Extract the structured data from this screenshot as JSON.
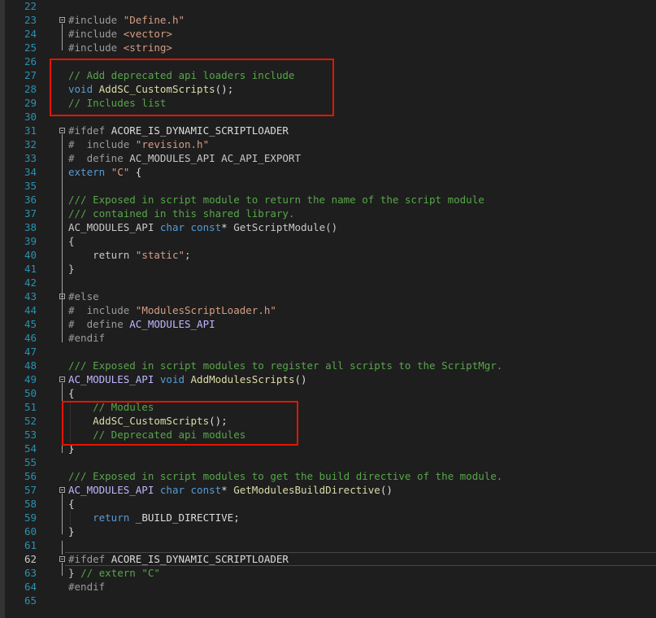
{
  "editor": {
    "current_line": 62,
    "lines": [
      {
        "n": 22,
        "tokens": []
      },
      {
        "n": 23,
        "tokens": [
          {
            "c": "pre",
            "t": "#include "
          },
          {
            "c": "str",
            "t": "\"Define.h\""
          }
        ]
      },
      {
        "n": 24,
        "tokens": [
          {
            "c": "pre",
            "t": "#include "
          },
          {
            "c": "str",
            "t": "<vector>"
          }
        ]
      },
      {
        "n": 25,
        "tokens": [
          {
            "c": "pre",
            "t": "#include "
          },
          {
            "c": "str",
            "t": "<string>"
          }
        ]
      },
      {
        "n": 26,
        "tokens": []
      },
      {
        "n": 27,
        "tokens": [
          {
            "c": "com",
            "t": "// Add deprecated api loaders include"
          }
        ]
      },
      {
        "n": 28,
        "tokens": [
          {
            "c": "kw",
            "t": "void "
          },
          {
            "c": "fn",
            "t": "AddSC_CustomScripts"
          },
          {
            "c": "txt",
            "t": "();"
          }
        ]
      },
      {
        "n": 29,
        "tokens": [
          {
            "c": "com",
            "t": "// Includes list"
          }
        ]
      },
      {
        "n": 30,
        "tokens": []
      },
      {
        "n": 31,
        "tokens": [
          {
            "c": "pre",
            "t": "#ifdef "
          },
          {
            "c": "txt",
            "t": "ACORE_IS_DYNAMIC_SCRIPTLOADER"
          }
        ]
      },
      {
        "n": 32,
        "tokens": [
          {
            "c": "pre",
            "t": "#  include "
          },
          {
            "c": "str",
            "t": "\"revision.h\""
          }
        ]
      },
      {
        "n": 33,
        "tokens": [
          {
            "c": "pre",
            "t": "#  define "
          },
          {
            "c": "def",
            "t": "AC_MODULES_API AC_API_EXPORT"
          }
        ]
      },
      {
        "n": 34,
        "tokens": [
          {
            "c": "kw",
            "t": "extern "
          },
          {
            "c": "str",
            "t": "\"C\""
          },
          {
            "c": "txt",
            "t": " {"
          }
        ]
      },
      {
        "n": 35,
        "tokens": []
      },
      {
        "n": 36,
        "tokens": [
          {
            "c": "com",
            "t": "/// Exposed in script module to return the name of the script module"
          }
        ]
      },
      {
        "n": 37,
        "tokens": [
          {
            "c": "com",
            "t": "/// contained in this shared library."
          }
        ]
      },
      {
        "n": 38,
        "tokens": [
          {
            "c": "def",
            "t": "AC_MODULES_API "
          },
          {
            "c": "kw",
            "t": "char const"
          },
          {
            "c": "txt",
            "t": "* "
          },
          {
            "c": "def",
            "t": "GetScriptModule()"
          }
        ]
      },
      {
        "n": 39,
        "tokens": [
          {
            "c": "def",
            "t": "{"
          }
        ]
      },
      {
        "n": 40,
        "tokens": [
          {
            "c": "def",
            "t": "    return "
          },
          {
            "c": "str",
            "t": "\"static\""
          },
          {
            "c": "def",
            "t": ";"
          }
        ]
      },
      {
        "n": 41,
        "tokens": [
          {
            "c": "def",
            "t": "}"
          }
        ]
      },
      {
        "n": 42,
        "tokens": []
      },
      {
        "n": 43,
        "tokens": [
          {
            "c": "pre",
            "t": "#else"
          }
        ]
      },
      {
        "n": 44,
        "tokens": [
          {
            "c": "pre",
            "t": "#  include "
          },
          {
            "c": "str",
            "t": "\"ModulesScriptLoader.h\""
          }
        ]
      },
      {
        "n": 45,
        "tokens": [
          {
            "c": "pre",
            "t": "#  define "
          },
          {
            "c": "macd",
            "t": "AC_MODULES_API"
          }
        ]
      },
      {
        "n": 46,
        "tokens": [
          {
            "c": "pre",
            "t": "#endif"
          }
        ]
      },
      {
        "n": 47,
        "tokens": []
      },
      {
        "n": 48,
        "tokens": [
          {
            "c": "com",
            "t": "/// Exposed in script modules to register all scripts to the ScriptMgr."
          }
        ]
      },
      {
        "n": 49,
        "tokens": [
          {
            "c": "macd",
            "t": "AC_MODULES_API "
          },
          {
            "c": "kw",
            "t": "void "
          },
          {
            "c": "fn",
            "t": "AddModulesScripts"
          },
          {
            "c": "txt",
            "t": "()"
          }
        ]
      },
      {
        "n": 50,
        "tokens": [
          {
            "c": "txt",
            "t": "{"
          }
        ]
      },
      {
        "n": 51,
        "tokens": [
          {
            "c": "com",
            "t": "    // Modules"
          }
        ]
      },
      {
        "n": 52,
        "tokens": [
          {
            "c": "fn",
            "t": "    AddSC_CustomScripts"
          },
          {
            "c": "txt",
            "t": "();"
          }
        ]
      },
      {
        "n": 53,
        "tokens": [
          {
            "c": "com",
            "t": "    // Deprecated api modules"
          }
        ]
      },
      {
        "n": 54,
        "tokens": [
          {
            "c": "txt",
            "t": "}"
          }
        ]
      },
      {
        "n": 55,
        "tokens": []
      },
      {
        "n": 56,
        "tokens": [
          {
            "c": "com",
            "t": "/// Exposed in script modules to get the build directive of the module."
          }
        ]
      },
      {
        "n": 57,
        "tokens": [
          {
            "c": "macd",
            "t": "AC_MODULES_API "
          },
          {
            "c": "kw",
            "t": "char const"
          },
          {
            "c": "txt",
            "t": "* "
          },
          {
            "c": "fn",
            "t": "GetModulesBuildDirective"
          },
          {
            "c": "txt",
            "t": "()"
          }
        ]
      },
      {
        "n": 58,
        "tokens": [
          {
            "c": "txt",
            "t": "{"
          }
        ]
      },
      {
        "n": 59,
        "tokens": [
          {
            "c": "kw",
            "t": "    return "
          },
          {
            "c": "txt",
            "t": "_BUILD_DIRECTIVE;"
          }
        ]
      },
      {
        "n": 60,
        "tokens": [
          {
            "c": "txt",
            "t": "}"
          }
        ]
      },
      {
        "n": 61,
        "tokens": []
      },
      {
        "n": 62,
        "tokens": [
          {
            "c": "pre",
            "t": "#ifdef "
          },
          {
            "c": "txt",
            "t": "ACORE_IS_DYNAMIC_SCRIPTLOADER"
          }
        ]
      },
      {
        "n": 63,
        "tokens": [
          {
            "c": "def",
            "t": "} "
          },
          {
            "c": "com",
            "t": "// extern \"C\""
          }
        ]
      },
      {
        "n": 64,
        "tokens": [
          {
            "c": "pre",
            "t": "#endif"
          }
        ]
      },
      {
        "n": 65,
        "tokens": []
      }
    ]
  }
}
